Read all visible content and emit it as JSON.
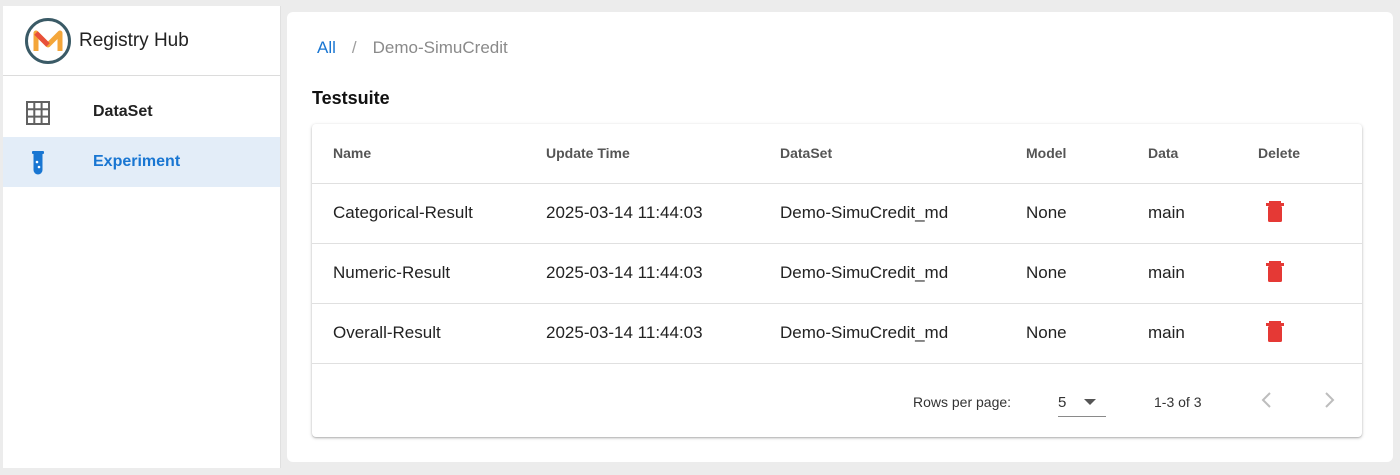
{
  "brand": {
    "title": "Registry Hub",
    "logo_icon": "m-logo-icon"
  },
  "sidebar": {
    "items": [
      {
        "label": "DataSet",
        "icon": "grid-icon",
        "active": false
      },
      {
        "label": "Experiment",
        "icon": "test-tube-icon",
        "active": true
      }
    ]
  },
  "breadcrumb": {
    "root": "All",
    "separator": "/",
    "current": "Demo-SimuCredit"
  },
  "section": {
    "title": "Testsuite"
  },
  "table": {
    "headers": {
      "name": "Name",
      "update_time": "Update Time",
      "dataset": "DataSet",
      "model": "Model",
      "data": "Data",
      "delete": "Delete"
    },
    "rows": [
      {
        "name": "Categorical-Result",
        "update_time": "2025-03-14 11:44:03",
        "dataset": "Demo-SimuCredit_md",
        "model": "None",
        "data": "main"
      },
      {
        "name": "Numeric-Result",
        "update_time": "2025-03-14 11:44:03",
        "dataset": "Demo-SimuCredit_md",
        "model": "None",
        "data": "main"
      },
      {
        "name": "Overall-Result",
        "update_time": "2025-03-14 11:44:03",
        "dataset": "Demo-SimuCredit_md",
        "model": "None",
        "data": "main"
      }
    ]
  },
  "pagination": {
    "rows_per_page_label": "Rows per page:",
    "rows_per_page": "5",
    "range": "1-3 of 3"
  },
  "colors": {
    "accent": "#1976d2",
    "delete": "#e53935",
    "active_bg": "#e3edf8"
  }
}
